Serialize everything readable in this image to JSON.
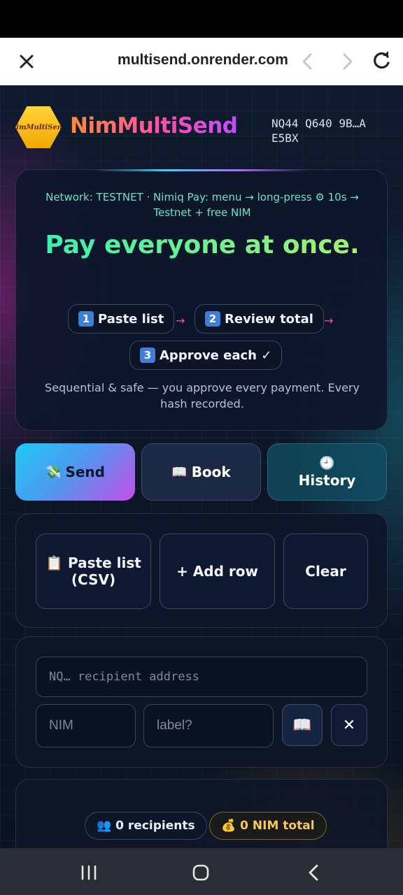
{
  "browser": {
    "url": "multisend.onrender.com"
  },
  "header": {
    "logo_text": "NimMultiSend",
    "brand": "NimMultiSend",
    "wallet_address": "NQ44 Q640 9B…A E5BX"
  },
  "hero": {
    "network_note": "Network: TESTNET · Nimiq Pay: menu → long-press ⚙ 10s → Testnet + free NIM",
    "headline": "Pay everyone at once.",
    "steps": [
      {
        "num": "1",
        "label": "Paste list"
      },
      {
        "num": "2",
        "label": "Review total"
      },
      {
        "num": "3",
        "label": "Approve each ✓"
      }
    ],
    "arrow": "→",
    "subtitle": "Sequential & safe — you approve every payment. Every hash recorded."
  },
  "tabs": [
    {
      "icon": "💸",
      "label": "Send"
    },
    {
      "icon": "📖",
      "label": "Book"
    },
    {
      "icon": "🕘",
      "label": "History"
    }
  ],
  "actions": {
    "paste_icon": "📋",
    "paste_label": "Paste list (CSV)",
    "add_label": "+ Add row",
    "clear_label": "Clear"
  },
  "entry": {
    "address_placeholder": "NQ… recipient address",
    "amount_placeholder": "NIM",
    "label_placeholder": "label?",
    "book_icon": "📖",
    "remove_icon": "✕"
  },
  "summary": {
    "recipients_icon": "👥",
    "recipients": "0 recipients",
    "total_icon": "💰",
    "total": "0 NIM total"
  },
  "colors": {
    "accent_cyan": "#22c8f5",
    "accent_magenta": "#c64de8",
    "headline_green": "#38f0b0",
    "network_text": "#6fe3c0",
    "gold": "#f6c85a"
  }
}
